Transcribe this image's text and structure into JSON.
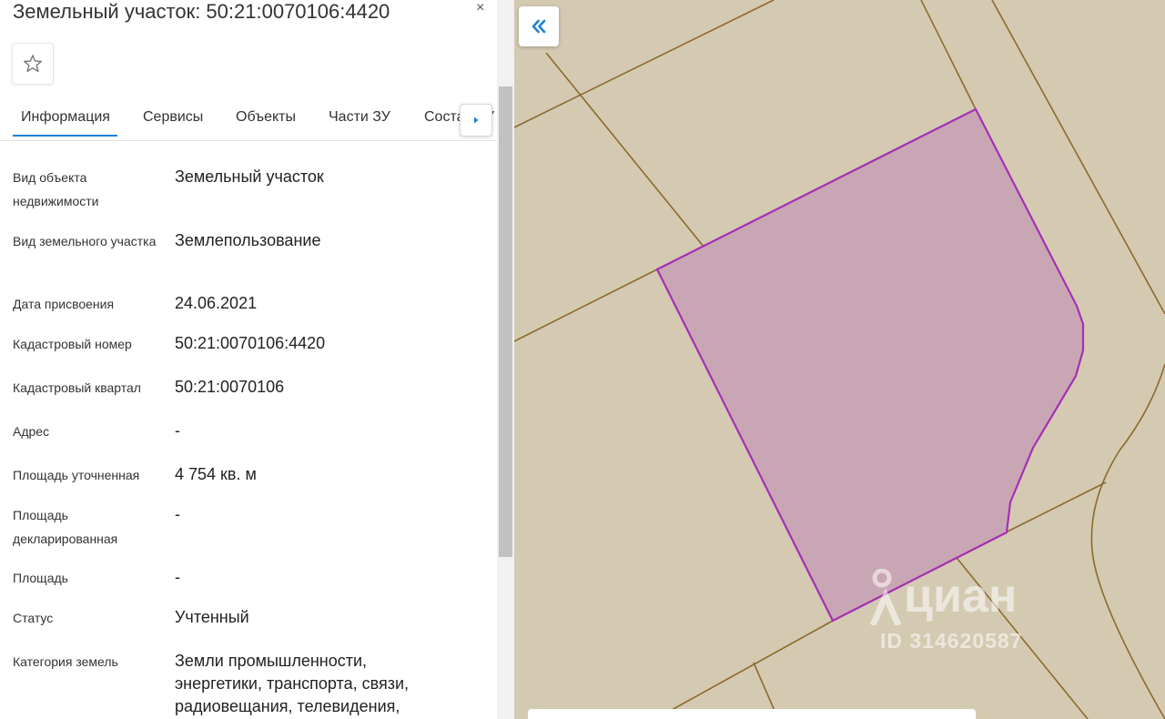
{
  "panel": {
    "title": "Земельный участок: 50:21:0070106:4420",
    "close_label": "×",
    "tabs": [
      {
        "label": "Информация"
      },
      {
        "label": "Сервисы"
      },
      {
        "label": "Объекты"
      },
      {
        "label": "Части ЗУ"
      },
      {
        "label": "Состав ЗУ"
      }
    ],
    "rows": [
      {
        "label": "Вид объекта недвижимости",
        "value": "Земельный участок"
      },
      {
        "label": "Вид земельного участка",
        "value": "Землепользование"
      },
      {
        "label": "Дата присвоения",
        "value": "24.06.2021"
      },
      {
        "label": "Кадастровый номер",
        "value": "50:21:0070106:4420"
      },
      {
        "label": "Кадастровый квартал",
        "value": "50:21:0070106"
      },
      {
        "label": "Адрес",
        "value": "-"
      },
      {
        "label": "Площадь уточненная",
        "value": "4 754 кв. м"
      },
      {
        "label": "Площадь декларированная",
        "value": "-"
      },
      {
        "label": "Площадь",
        "value": "-"
      },
      {
        "label": "Статус",
        "value": "Учтенный"
      },
      {
        "label": "Категория земель",
        "value": "Земли промышленности, энергетики, транспорта, связи, радиовещания, телевидения,"
      }
    ]
  },
  "map": {
    "watermark_brand": "циан",
    "watermark_id": "ID 314620587",
    "parcel_fill": "#c9a6b4",
    "parcel_stroke": "#a62fb5",
    "boundary_color": "#8b6a2e",
    "background": "#d4cab2"
  },
  "icons": {
    "favorite": "star-outline-icon",
    "tab_next": "caret-right-icon",
    "collapse": "double-chevron-left-icon"
  }
}
